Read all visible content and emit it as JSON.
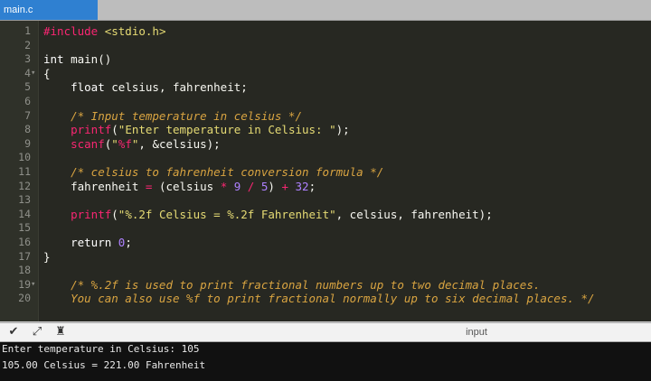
{
  "tab": {
    "label": "main.c"
  },
  "editor": {
    "lines": [
      {
        "n": "1",
        "fold": "",
        "tokens": [
          [
            "pre",
            "#include "
          ],
          [
            "inc",
            "<stdio.h>"
          ]
        ]
      },
      {
        "n": "2",
        "fold": "",
        "tokens": []
      },
      {
        "n": "3",
        "fold": "",
        "tokens": [
          [
            "kw",
            "int "
          ],
          [
            "id",
            "main()"
          ]
        ]
      },
      {
        "n": "4",
        "fold": "▾",
        "tokens": [
          [
            "id",
            "{"
          ]
        ]
      },
      {
        "n": "5",
        "fold": "",
        "tokens": [
          [
            "kw",
            "    float "
          ],
          [
            "id",
            "celsius, fahrenheit;"
          ]
        ]
      },
      {
        "n": "6",
        "fold": "",
        "tokens": []
      },
      {
        "n": "7",
        "fold": "",
        "tokens": [
          [
            "cm",
            "    /* Input temperature in celsius */"
          ]
        ]
      },
      {
        "n": "8",
        "fold": "",
        "tokens": [
          [
            "fn",
            "    printf"
          ],
          [
            "id",
            "("
          ],
          [
            "str",
            "\"Enter temperature in Celsius: \""
          ],
          [
            "id",
            ");"
          ]
        ]
      },
      {
        "n": "9",
        "fold": "",
        "tokens": [
          [
            "fn",
            "    scanf"
          ],
          [
            "id",
            "("
          ],
          [
            "str",
            "\""
          ],
          [
            "fmt2",
            "%f"
          ],
          [
            "str",
            "\""
          ],
          [
            "id",
            ", &celsius);"
          ]
        ]
      },
      {
        "n": "10",
        "fold": "",
        "tokens": []
      },
      {
        "n": "11",
        "fold": "",
        "tokens": [
          [
            "cm",
            "    /* celsius to fahrenheit conversion formula */"
          ]
        ]
      },
      {
        "n": "12",
        "fold": "",
        "tokens": [
          [
            "id",
            "    fahrenheit "
          ],
          [
            "op",
            "="
          ],
          [
            "id",
            " (celsius "
          ],
          [
            "op",
            "*"
          ],
          [
            "num",
            " 9 "
          ],
          [
            "op",
            "/"
          ],
          [
            "num",
            " 5"
          ],
          [
            "id",
            ") "
          ],
          [
            "op",
            "+"
          ],
          [
            "num",
            " 32"
          ],
          [
            "id",
            ";"
          ]
        ]
      },
      {
        "n": "13",
        "fold": "",
        "tokens": []
      },
      {
        "n": "14",
        "fold": "",
        "tokens": [
          [
            "fn",
            "    printf"
          ],
          [
            "id",
            "("
          ],
          [
            "str",
            "\"%.2f Celsius = %.2f Fahrenheit\""
          ],
          [
            "id",
            ", celsius, fahrenheit);"
          ]
        ]
      },
      {
        "n": "15",
        "fold": "",
        "tokens": []
      },
      {
        "n": "16",
        "fold": "",
        "tokens": [
          [
            "kw",
            "    return "
          ],
          [
            "num",
            "0"
          ],
          [
            "id",
            ";"
          ]
        ]
      },
      {
        "n": "17",
        "fold": "",
        "tokens": [
          [
            "id",
            "}"
          ]
        ]
      },
      {
        "n": "18",
        "fold": "",
        "tokens": []
      },
      {
        "n": "19",
        "fold": "▾",
        "tokens": [
          [
            "cm",
            "    /* %.2f is used to print fractional numbers up to two decimal places."
          ]
        ]
      },
      {
        "n": "20",
        "fold": "",
        "tokens": [
          [
            "cm",
            "    You can also use %f to print fractional normally up to six decimal places. */"
          ]
        ]
      }
    ]
  },
  "toolbar": {
    "icons": [
      "chevron-down-icon",
      "expand-icon",
      "stop-icon"
    ],
    "glyphs": [
      "✔",
      "⤢",
      "♜"
    ],
    "input_label": "input"
  },
  "console": {
    "lines": [
      "Enter temperature in Celsius: 105",
      "105.00 Celsius = 221.00 Fahrenheit"
    ]
  },
  "colors": {
    "tab_active": "#2f80d1",
    "editor_bg": "#272822",
    "console_bg": "#111111"
  }
}
